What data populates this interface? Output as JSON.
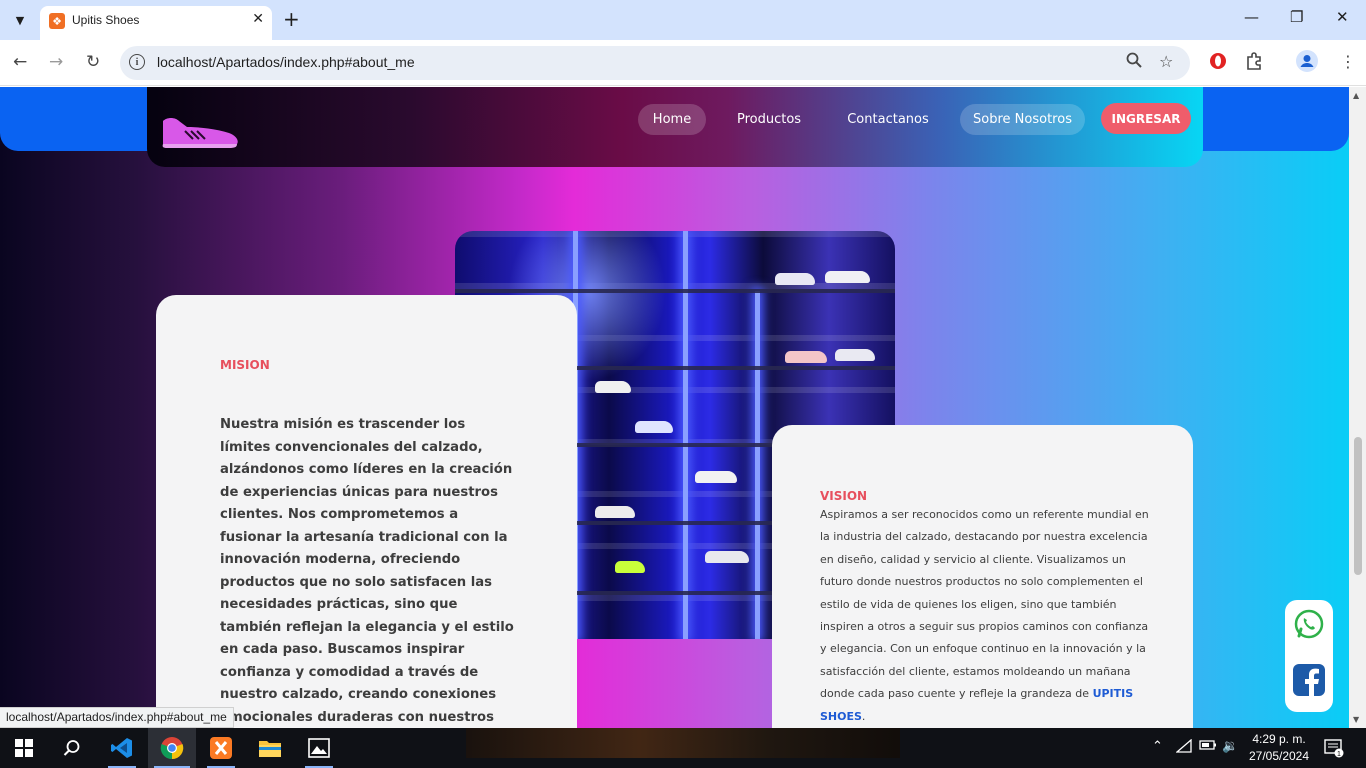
{
  "browser": {
    "tab_title": "Upitis Shoes",
    "url": "localhost/Apartados/index.php#about_me",
    "status_url": "localhost/Apartados/index.php#about_me"
  },
  "nav": {
    "home": "Home",
    "productos": "Productos",
    "contactanos": "Contactanos",
    "sobre_nosotros": "Sobre Nosotros",
    "ingresar": "INGRESAR"
  },
  "mision": {
    "title": "MISION",
    "text": "Nuestra misión es trascender los límites convencionales del calzado, alzándonos como líderes en la creación de experiencias únicas para nuestros clientes. Nos comprometemos a fusionar la artesanía tradicional con la innovación moderna, ofreciendo productos que no solo satisfacen las necesidades prácticas, sino que también reflejan la elegancia y el estilo en cada paso. Buscamos inspirar confianza y comodidad a través de nuestro calzado, creando conexiones emocionales duraderas con nuestros clientes y elevando la forma en que experimentan el mundo a través de sus pies."
  },
  "vision": {
    "title": "VISION",
    "text": "Aspiramos a ser reconocidos como un referente mundial en la industria del calzado, destacando por nuestra excelencia en diseño, calidad y servicio al cliente. Visualizamos un futuro donde nuestros productos no solo complementen el estilo de vida de quienes los eligen, sino que también inspiren a otros a seguir sus propios caminos con confianza y elegancia. Con un enfoque continuo en la innovación y la satisfacción del cliente, estamos moldeando un mañana donde cada paso cuente y refleje la grandeza de",
    "brand": "UPITIS SHOES",
    "end": "."
  },
  "taskbar": {
    "time": "4:29 p. m.",
    "date": "27/05/2024",
    "notification_count": "1"
  },
  "colors": {
    "accent_red": "#e74f5d",
    "brand_blue": "#1e5bd4",
    "ingresar_bg": "#ef5d6b",
    "navbar_band": "#0a63f2"
  }
}
